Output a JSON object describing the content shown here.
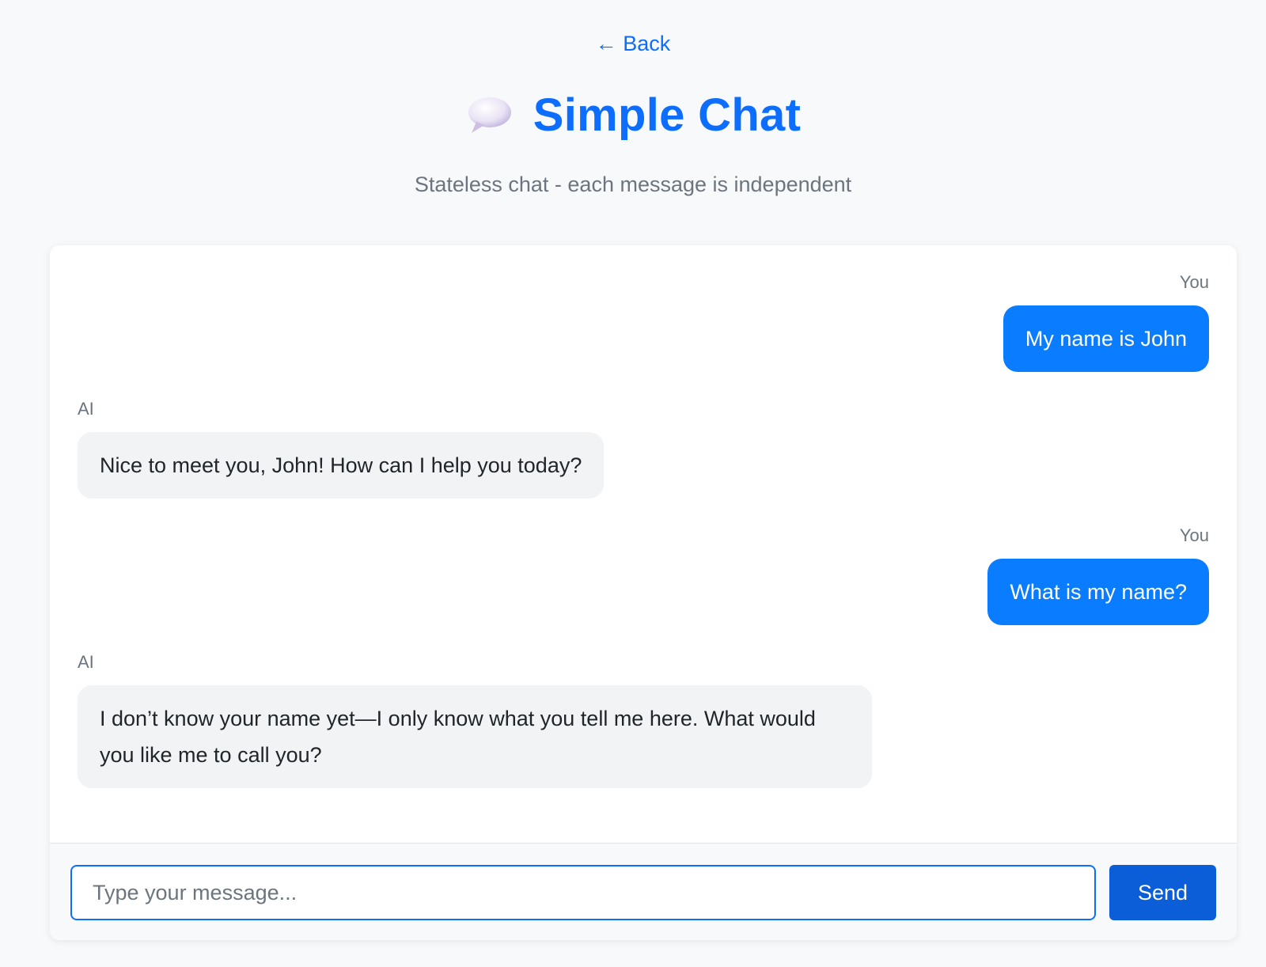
{
  "nav": {
    "back_label": "← Back"
  },
  "header": {
    "icon": "speech-bubble-icon",
    "title": "Simple Chat",
    "subtitle": "Stateless chat - each message is independent"
  },
  "messages": [
    {
      "role": "user",
      "sender": "You",
      "text": "My name is John"
    },
    {
      "role": "ai",
      "sender": "AI",
      "text": "Nice to meet you, John! How can I help you today?"
    },
    {
      "role": "user",
      "sender": "You",
      "text": "What is my name?"
    },
    {
      "role": "ai",
      "sender": "AI",
      "text": "I don’t know your name yet—I only know what you tell me here. What would you like me to call you?"
    }
  ],
  "composer": {
    "placeholder": "Type your message...",
    "value": "",
    "send_label": "Send"
  },
  "colors": {
    "accent": "#0d6efd",
    "user_bubble": "#0a7cff",
    "ai_bubble": "#f1f3f5",
    "send_button": "#0b5ed7"
  }
}
